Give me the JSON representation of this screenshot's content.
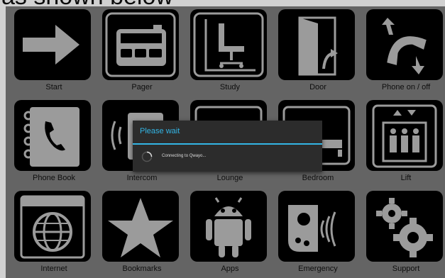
{
  "page_caption": "as shown below",
  "colors": {
    "screen_bg": "#7b7b7b",
    "tile_bg": "#000000",
    "dialog_bg": "#2c2c2c",
    "accent": "#33b5e5"
  },
  "tiles": [
    {
      "label": "Start",
      "icon": "arrow-right-icon"
    },
    {
      "label": "Pager",
      "icon": "pager-icon"
    },
    {
      "label": "Study",
      "icon": "office-chair-icon"
    },
    {
      "label": "Door",
      "icon": "door-icon"
    },
    {
      "label": "Phone on / off",
      "icon": "phone-handset-icon"
    },
    {
      "label": "Phone Book",
      "icon": "phone-book-icon"
    },
    {
      "label": "Intercom",
      "icon": "intercom-icon"
    },
    {
      "label": "Lounge",
      "icon": "lounge-icon"
    },
    {
      "label": "Bedroom",
      "icon": "bed-icon"
    },
    {
      "label": "Lift",
      "icon": "lift-icon"
    },
    {
      "label": "Internet",
      "icon": "globe-icon"
    },
    {
      "label": "Bookmarks",
      "icon": "star-icon"
    },
    {
      "label": "Apps",
      "icon": "android-icon"
    },
    {
      "label": "Emergency",
      "icon": "emergency-alarm-icon"
    },
    {
      "label": "Support",
      "icon": "gears-icon"
    }
  ],
  "dialog": {
    "title": "Please wait",
    "message": "Connecting to Qwayo..."
  }
}
